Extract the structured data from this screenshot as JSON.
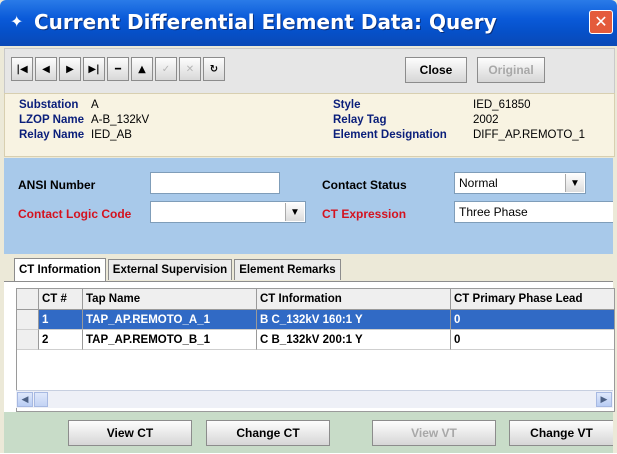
{
  "window": {
    "title": "Current Differential Element Data: Query",
    "close_glyph": "✕"
  },
  "toolbar": {
    "nav_icons": [
      "first-record-icon",
      "previous-record-icon",
      "next-record-icon",
      "last-record-icon",
      "delete-record-icon",
      "up-icon",
      "confirm-icon",
      "cancel-icon",
      "refresh-icon"
    ],
    "close_label": "Close",
    "original_label": "Original"
  },
  "info": {
    "substation_label": "Substation",
    "substation_value": "A",
    "lzop_label": "LZOP Name",
    "lzop_value": "A-B_132kV",
    "relay_label": "Relay Name",
    "relay_value": "IED_AB",
    "style_label": "Style",
    "style_value": "IED_61850",
    "relay_tag_label": "Relay Tag",
    "relay_tag_value": "2002",
    "element_designation_label": "Element Designation",
    "element_designation_value": "DIFF_AP.REMOTO_1"
  },
  "form": {
    "ansi_label": "ANSI Number",
    "ansi_value": "",
    "contact_status_label": "Contact Status",
    "contact_status_value": "Normal",
    "contact_logic_label": "Contact Logic Code",
    "contact_logic_value": "",
    "ct_expression_label": "CT Expression",
    "ct_expression_value": "Three Phase"
  },
  "tabs": [
    "CT Information",
    "External Supervision",
    "Element Remarks"
  ],
  "table": {
    "columns": [
      "CT #",
      "Tap Name",
      "CT Information",
      "CT Primary Phase Lead"
    ],
    "rows": [
      {
        "ct": "1",
        "tap": "TAP_AP.REMOTO_A_1",
        "info": "B C_132kV 160:1 Y",
        "lead": "0"
      },
      {
        "ct": "2",
        "tap": "TAP_AP.REMOTO_B_1",
        "info": "C B_132kV 200:1 Y",
        "lead": "0"
      }
    ]
  },
  "buttons": {
    "view_ct": "View CT",
    "change_ct": "Change CT",
    "view_vt": "View VT",
    "change_vt": "Change VT"
  },
  "colors": {
    "title_bar": "#0a5ad9",
    "info_panel": "#f8f3e2",
    "form_panel": "#a8c9ea",
    "required_label": "#d4121f",
    "selected_row": "#316ac5",
    "bottom_bar": "#c8dcc8"
  }
}
